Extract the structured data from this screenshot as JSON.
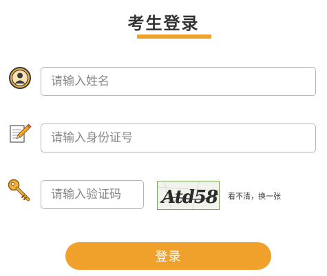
{
  "page": {
    "title": "考生登录",
    "accent_color": "#efa12b"
  },
  "form": {
    "name_placeholder": "请输入姓名",
    "id_placeholder": "请输入身份证号",
    "code_placeholder": "请输入验证码",
    "captcha_text": "Atd58",
    "refresh_label": "看不清，换一张",
    "submit_label": "登录"
  },
  "icons": {
    "name": "user-avatar-icon",
    "id": "pencil-note-icon",
    "code": "key-icon"
  }
}
